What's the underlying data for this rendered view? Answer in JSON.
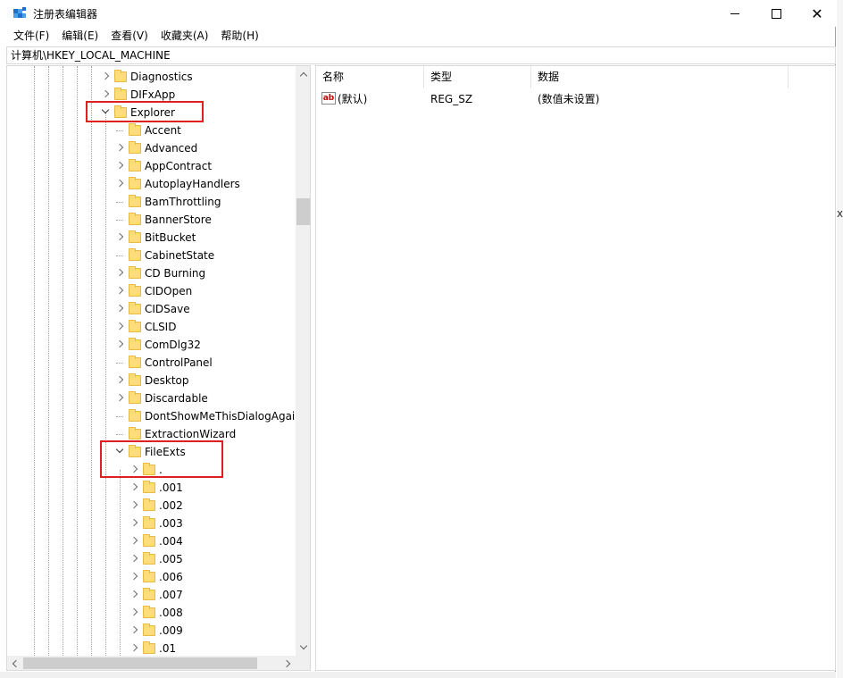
{
  "window": {
    "title": "注册表编辑器",
    "controls": {
      "minimize": "",
      "maximize": "",
      "close": "✕"
    }
  },
  "menu": [
    "文件(F)",
    "编辑(E)",
    "查看(V)",
    "收藏夹(A)",
    "帮助(H)"
  ],
  "address": "计算机\\HKEY_LOCAL_MACHINE",
  "tree": {
    "rows": [
      {
        "label": "Diagnostics",
        "level": 0,
        "state": "collapsed"
      },
      {
        "label": "DIFxApp",
        "level": 0,
        "state": "collapsed"
      },
      {
        "label": "Explorer",
        "level": 0,
        "state": "expanded",
        "highlighted": true
      },
      {
        "label": "Accent",
        "level": 1,
        "state": "none"
      },
      {
        "label": "Advanced",
        "level": 1,
        "state": "collapsed"
      },
      {
        "label": "AppContract",
        "level": 1,
        "state": "collapsed"
      },
      {
        "label": "AutoplayHandlers",
        "level": 1,
        "state": "collapsed"
      },
      {
        "label": "BamThrottling",
        "level": 1,
        "state": "none"
      },
      {
        "label": "BannerStore",
        "level": 1,
        "state": "none"
      },
      {
        "label": "BitBucket",
        "level": 1,
        "state": "collapsed"
      },
      {
        "label": "CabinetState",
        "level": 1,
        "state": "none"
      },
      {
        "label": "CD Burning",
        "level": 1,
        "state": "collapsed"
      },
      {
        "label": "CIDOpen",
        "level": 1,
        "state": "collapsed"
      },
      {
        "label": "CIDSave",
        "level": 1,
        "state": "collapsed"
      },
      {
        "label": "CLSID",
        "level": 1,
        "state": "collapsed"
      },
      {
        "label": "ComDlg32",
        "level": 1,
        "state": "collapsed"
      },
      {
        "label": "ControlPanel",
        "level": 1,
        "state": "none"
      },
      {
        "label": "Desktop",
        "level": 1,
        "state": "collapsed"
      },
      {
        "label": "Discardable",
        "level": 1,
        "state": "collapsed"
      },
      {
        "label": "DontShowMeThisDialogAgain",
        "level": 1,
        "state": "none"
      },
      {
        "label": "ExtractionWizard",
        "level": 1,
        "state": "none"
      },
      {
        "label": "FileExts",
        "level": 1,
        "state": "expanded",
        "highlighted": true
      },
      {
        "label": ".",
        "level": 2,
        "state": "collapsed"
      },
      {
        "label": ".001",
        "level": 2,
        "state": "collapsed"
      },
      {
        "label": ".002",
        "level": 2,
        "state": "collapsed"
      },
      {
        "label": ".003",
        "level": 2,
        "state": "collapsed"
      },
      {
        "label": ".004",
        "level": 2,
        "state": "collapsed"
      },
      {
        "label": ".005",
        "level": 2,
        "state": "collapsed"
      },
      {
        "label": ".006",
        "level": 2,
        "state": "collapsed"
      },
      {
        "label": ".007",
        "level": 2,
        "state": "collapsed"
      },
      {
        "label": ".008",
        "level": 2,
        "state": "collapsed"
      },
      {
        "label": ".009",
        "level": 2,
        "state": "collapsed"
      },
      {
        "label": ".01",
        "level": 2,
        "state": "collapsed"
      }
    ]
  },
  "list": {
    "headers": {
      "name": "名称",
      "type": "类型",
      "data": "数据"
    },
    "rows": [
      {
        "icon": "ab",
        "name": "(默认)",
        "type": "REG_SZ",
        "data": "(数值未设置)"
      }
    ]
  },
  "edge_text": "x",
  "colors": {
    "highlight_box": "#e02020",
    "folder": "#fddc7a",
    "folder_border": "#e6b943"
  }
}
